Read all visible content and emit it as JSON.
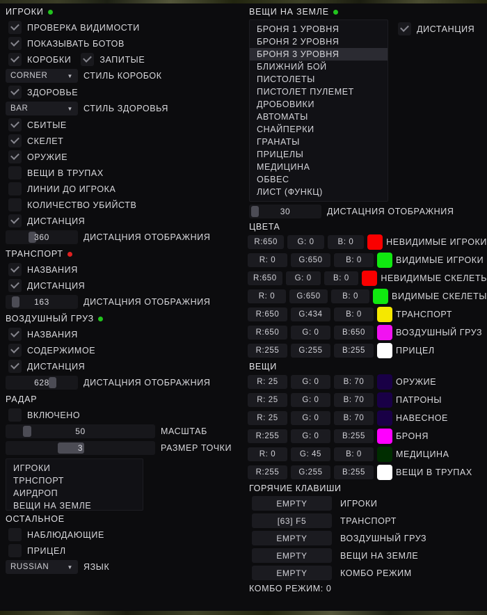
{
  "theme": {
    "bg": "#0c0c0e",
    "text": "#d9d9dd",
    "field": "#1b1b20",
    "on_dot": "#22c31e",
    "off_dot": "#e02020"
  },
  "left": {
    "players": {
      "title": "ИГРОКИ",
      "status_color": "#22c31e",
      "checks": [
        {
          "label": "ПРОВЕРКА ВИДИМОСТИ",
          "checked": true
        },
        {
          "label": "ПОКАЗЫВАТЬ БОТОВ",
          "checked": true
        }
      ],
      "box_row": [
        {
          "label": "КОРОБКИ",
          "checked": true
        },
        {
          "label": "ЗАПИТЫЕ",
          "checked": true
        }
      ],
      "box_style": {
        "value": "CORNER",
        "label": "СТИЛЬ КОРОБОК",
        "caret": "chevron-down-icon"
      },
      "health": {
        "label": "ЗДОРОВЬЕ",
        "checked": true
      },
      "health_style": {
        "value": "BAR",
        "label": "СТИЛЬ ЗДОРОВЬЯ",
        "caret": "chevron-down-icon"
      },
      "checks2": [
        {
          "label": "СБИТЫЕ",
          "checked": true
        },
        {
          "label": "СКЕЛЕТ",
          "checked": true
        },
        {
          "label": "ОРУЖИЕ",
          "checked": true
        },
        {
          "label": "ВЕЩИ В ТРУПАХ",
          "checked": false
        },
        {
          "label": "ЛИНИИ ДО ИГРОКА",
          "checked": false
        },
        {
          "label": "КОЛИЧЕСТВО УБИЙСТВ",
          "checked": false
        },
        {
          "label": "ДИСТАНЦИЯ",
          "checked": true
        }
      ],
      "distance_slider": {
        "value": "360",
        "label": "ДИСТАЦНИЯ ОТОБРАЖНИЯ",
        "percent": 33
      }
    },
    "transport": {
      "title": "ТРАНСПОРТ",
      "status_color": "#e02020",
      "checks": [
        {
          "label": "НАЗВАНИЯ",
          "checked": true
        },
        {
          "label": "ДИСТАНЦИЯ",
          "checked": true
        }
      ],
      "distance_slider": {
        "value": "163",
        "label": "ДИСТАЦНИЯ ОТОБРАЖНИЯ",
        "percent": 9
      }
    },
    "airdrop": {
      "title": "ВОЗДУШНЫЙ ГРУЗ",
      "status_color": "#22c31e",
      "checks": [
        {
          "label": "НАЗВАНИЯ",
          "checked": true
        },
        {
          "label": "СОДЕРЖИМОЕ",
          "checked": true
        },
        {
          "label": "ДИСТАНЦИЯ",
          "checked": true
        }
      ],
      "distance_slider": {
        "value": "628",
        "label": "ДИСТАЦНИЯ ОТОБРАЖНИЯ",
        "percent": 60
      }
    },
    "radar": {
      "title": "РАДАР",
      "enabled": {
        "label": "ВКЛЮЧЕНО",
        "checked": false
      },
      "scale_slider": {
        "value": "50",
        "label": "МАСШТАБ",
        "percent": 8
      },
      "dot_size_slider": {
        "value": "3",
        "label": "РАЗМЕР ТОЧКИ",
        "percent": 30
      },
      "items": [
        "ИГРОКИ",
        "ТРНСПОРТ",
        "АИРДРОП",
        "ВЕЩИ НА ЗЕМЛЕ"
      ]
    },
    "misc": {
      "title": "ОСТАЛЬНОЕ",
      "checks": [
        {
          "label": "НАБЛЮДАЮЩИЕ",
          "checked": false
        },
        {
          "label": "ПРИЦЕЛ",
          "checked": false
        }
      ],
      "language": {
        "value": "RUSSIAN",
        "label": "ЯЗЫК",
        "caret": "chevron-down-icon"
      }
    }
  },
  "right": {
    "ground_items": {
      "title": "ВЕЩИ НА ЗЕМЛЕ",
      "status_color": "#22c31e",
      "list": [
        {
          "label": "БРОНЯ 1 УРОВНЯ",
          "selected": false
        },
        {
          "label": "БРОНЯ 2 УРОВНЯ",
          "selected": false
        },
        {
          "label": "БРОНЯ 3 УРОВНЯ",
          "selected": true
        },
        {
          "label": "БЛИЖНИЙ БОЙ",
          "selected": false
        },
        {
          "label": "ПИСТОЛЕТЫ",
          "selected": false
        },
        {
          "label": "ПИСТОЛЕТ ПУЛЕМЕТ",
          "selected": false
        },
        {
          "label": "ДРОБОВИКИ",
          "selected": false
        },
        {
          "label": "АВТОМАТЫ",
          "selected": false
        },
        {
          "label": "СНАЙПЕРКИ",
          "selected": false
        },
        {
          "label": "ГРАНАТЫ",
          "selected": false
        },
        {
          "label": "ПРИЦЕЛЫ",
          "selected": false
        },
        {
          "label": "МЕДИЦИНА",
          "selected": false
        },
        {
          "label": "ОБВЕС",
          "selected": false
        },
        {
          "label": "ЛИСТ (ФУНКЦ)",
          "selected": false
        }
      ],
      "distance_check": {
        "label": "ДИСТАНЦИЯ",
        "checked": true
      },
      "distance_slider": {
        "value": "30",
        "label": "ДИСТАЦНИЯ ОТОБРАЖНИЯ",
        "percent": 3
      }
    },
    "colors": {
      "title": "ЦВЕТА",
      "rows": [
        {
          "r": "R:650",
          "g": "G:  0",
          "b": "B:  0",
          "swatch": "#fa0000",
          "name": "НЕВИДИМЫЕ ИГРОКИ"
        },
        {
          "r": "R:  0",
          "g": "G:650",
          "b": "B:  0",
          "swatch": "#10e810",
          "name": "ВИДИМЫЕ ИГРОКИ"
        },
        {
          "r": "R:650",
          "g": "G:  0",
          "b": "B:  0",
          "swatch": "#fa0000",
          "name": "НЕВИДИМЫЕ СКЕЛЕТЬ"
        },
        {
          "r": "R:  0",
          "g": "G:650",
          "b": "B:  0",
          "swatch": "#10e810",
          "name": "ВИДИМЫЕ СКЕЛЕТЫ"
        },
        {
          "r": "R:650",
          "g": "G:434",
          "b": "B:  0",
          "swatch": "#f5e800",
          "name": "ТРАНСПОРТ"
        },
        {
          "r": "R:650",
          "g": "G:  0",
          "b": "B:650",
          "swatch": "#f112f1",
          "name": "ВОЗДУШНЫЙ ГРУЗ"
        },
        {
          "r": "R:255",
          "g": "G:255",
          "b": "B:255",
          "swatch": "#ffffff",
          "name": "ПРИЦЕЛ"
        }
      ]
    },
    "item_colors": {
      "title": "ВЕЩИ",
      "rows": [
        {
          "r": "R: 25",
          "g": "G:  0",
          "b": "B: 70",
          "swatch": "#190046",
          "name": "ОРУЖИЕ"
        },
        {
          "r": "R: 25",
          "g": "G:  0",
          "b": "B: 70",
          "swatch": "#190046",
          "name": "ПАТРОНЫ"
        },
        {
          "r": "R: 25",
          "g": "G:  0",
          "b": "B: 70",
          "swatch": "#190046",
          "name": "НАВЕСНОЕ"
        },
        {
          "r": "R:255",
          "g": "G:  0",
          "b": "B:255",
          "swatch": "#ff00ff",
          "name": "БРОНЯ"
        },
        {
          "r": "R:  0",
          "g": "G: 45",
          "b": "B:  0",
          "swatch": "#002d00",
          "name": "МЕДИЦИНА"
        },
        {
          "r": "R:255",
          "g": "G:255",
          "b": "B:255",
          "swatch": "#ffffff",
          "name": "ВЕЩИ В ТРУПАХ"
        }
      ]
    },
    "hotkeys": {
      "title": "ГОРЯЧИЕ КЛАВИШИ",
      "rows": [
        {
          "key": "EMPTY",
          "name": "ИГРОКИ"
        },
        {
          "key": "[63] F5",
          "name": "ТРАНСПОРТ"
        },
        {
          "key": "EMPTY",
          "name": "ВОЗДУШНЫЙ ГРУЗ"
        },
        {
          "key": "EMPTY",
          "name": "ВЕЩИ НА ЗЕМЛЕ"
        },
        {
          "key": "EMPTY",
          "name": "КОМБО РЕЖИМ"
        }
      ],
      "combo_status": "КОМБО РЕЖИМ: 0"
    }
  }
}
